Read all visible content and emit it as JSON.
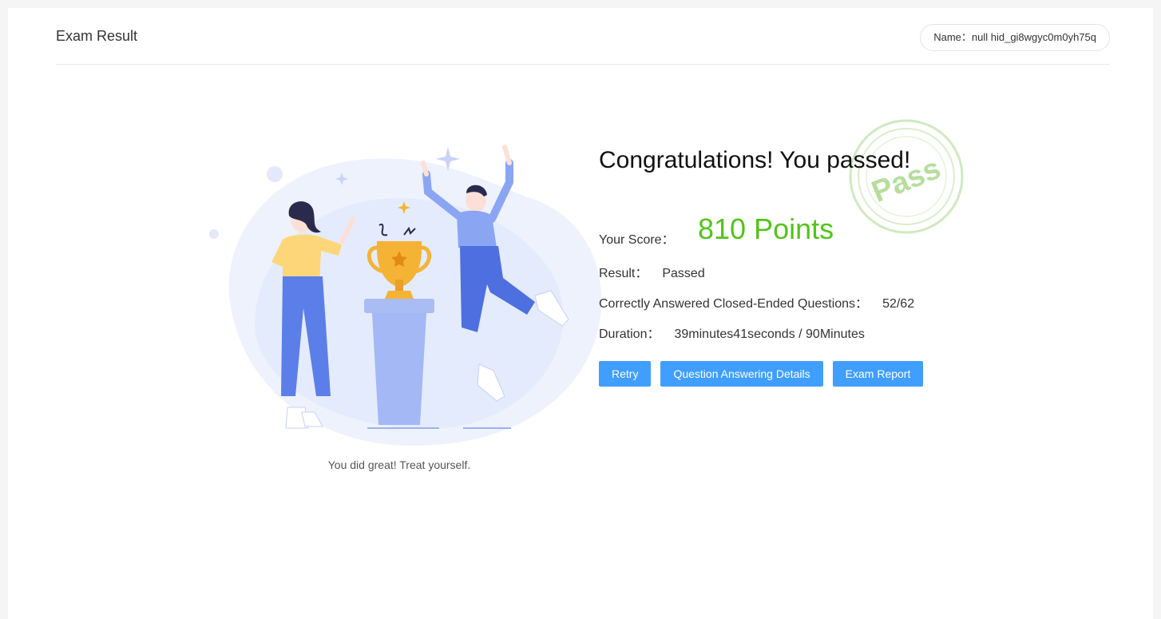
{
  "header": {
    "title": "Exam Result",
    "name_label": "Name：",
    "name_value": "null hid_gi8wgyc0m0yh75q"
  },
  "illustration": {
    "caption": "You did great! Treat yourself."
  },
  "stamp": {
    "text": "Pass",
    "color": "#a9d98b"
  },
  "result": {
    "headline": "Congratulations! You passed!",
    "score_label": "Your Score：",
    "score_value": "810 Points",
    "result_label": "Result：",
    "result_value": "Passed",
    "closed_label": "Correctly Answered Closed-Ended Questions：",
    "closed_value": "52/62",
    "duration_label": "Duration：",
    "duration_value": "39minutes41seconds / 90Minutes"
  },
  "buttons": {
    "retry": "Retry",
    "details": "Question Answering Details",
    "report": "Exam Report"
  },
  "colors": {
    "accent": "#409eff",
    "score": "#52c41a"
  }
}
